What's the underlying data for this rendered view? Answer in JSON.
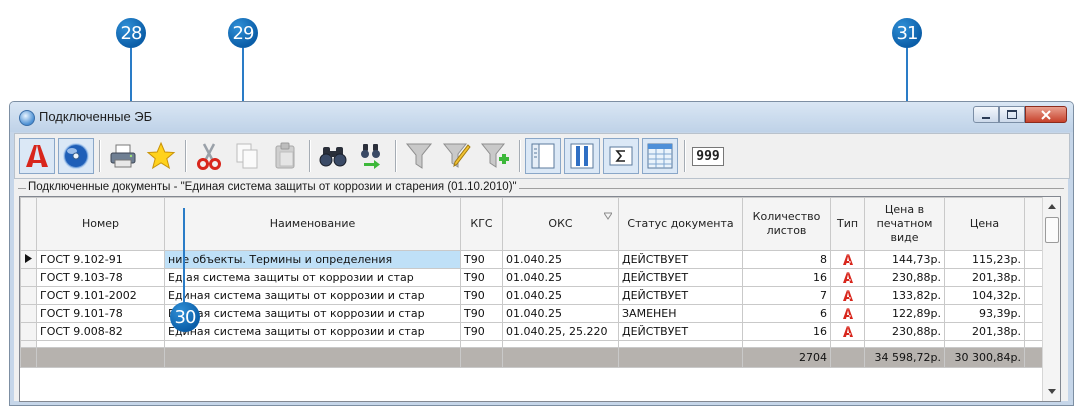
{
  "callouts": [
    "28",
    "29",
    "30",
    "31"
  ],
  "window": {
    "title": "Подключенные ЭБ"
  },
  "toolbar": {
    "icons": [
      "pdf-icon",
      "disc-icon",
      "printer-icon",
      "star-icon",
      "cut-icon",
      "copy-icon",
      "paste-icon",
      "binoculars-icon",
      "binoculars-next-icon",
      "filter-icon",
      "filter-edit-icon",
      "filter-add-icon",
      "panel-left-icon",
      "columns-icon",
      "sum-icon",
      "grid-icon",
      "counter-icon"
    ],
    "counter_value": "999"
  },
  "panel": {
    "caption": "Подключенные документы - \"Единая система защиты от коррозии и старения (01.10.2010)\""
  },
  "table": {
    "headers": {
      "number": "Номер",
      "name": "Наименование",
      "kgs": "КГС",
      "oks": "ОКС",
      "status": "Статус документа",
      "sheets_line1": "Количество",
      "sheets_line2": "листов",
      "type": "Тип",
      "print_price_line1": "Цена в",
      "print_price_line2": "печатном",
      "print_price_line3": "виде",
      "price": "Цена"
    },
    "rows": [
      {
        "number": "ГОСТ 9.102-91",
        "name": "ние объекты. Термины и определения",
        "kgs": "Т90",
        "oks": "01.040.25",
        "status": "ДЕЙСТВУЕТ",
        "sheets": "8",
        "print_price": "144,73р.",
        "price": "115,23р."
      },
      {
        "number": "ГОСТ 9.103-78",
        "name": "Ед      ая система защиты от коррозии и стар",
        "kgs": "Т90",
        "oks": "01.040.25",
        "status": "ДЕЙСТВУЕТ",
        "sheets": "16",
        "print_price": "230,88р.",
        "price": "201,38р."
      },
      {
        "number": "ГОСТ 9.101-2002",
        "name": "Единая система защиты от коррозии и стар",
        "kgs": "Т90",
        "oks": "01.040.25",
        "status": "ДЕЙСТВУЕТ",
        "sheets": "7",
        "print_price": "133,82р.",
        "price": "104,32р."
      },
      {
        "number": "ГОСТ 9.101-78",
        "name": "Единая система защиты от коррозии и стар",
        "kgs": "Т90",
        "oks": "01.040.25",
        "status": "ЗАМЕНЕН",
        "sheets": "6",
        "print_price": "122,89р.",
        "price": "93,39р."
      },
      {
        "number": "ГОСТ 9.008-82",
        "name": "Единая система защиты от коррозии и стар",
        "kgs": "Т90",
        "oks": "01.040.25, 25.220",
        "status": "ДЕЙСТВУЕТ",
        "sheets": "16",
        "print_price": "230,88р.",
        "price": "201,38р."
      }
    ],
    "totals": {
      "sheets": "2704",
      "print_price": "34 598,72р.",
      "price": "30 300,84р."
    }
  },
  "colors": {
    "callout": "#0b5ea8",
    "selection": "#bfe0f7",
    "total_row": "#b6b2ae",
    "pdf_red": "#d8261c"
  }
}
